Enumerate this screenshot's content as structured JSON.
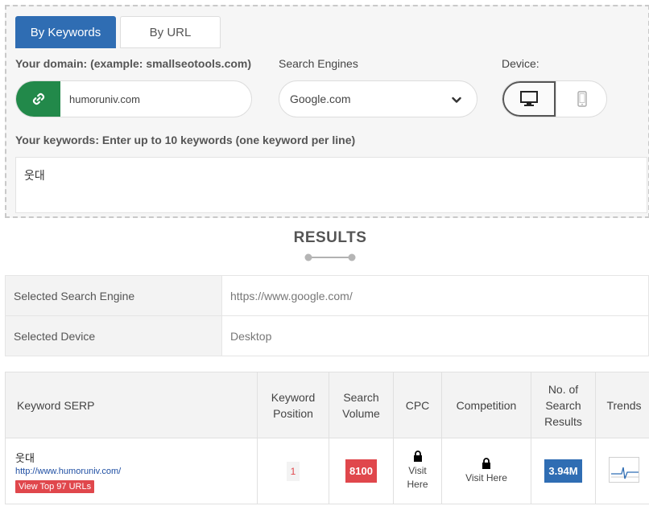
{
  "tabs": [
    {
      "label": "By Keywords",
      "active": true
    },
    {
      "label": "By URL",
      "active": false
    }
  ],
  "form": {
    "domain_label": "Your domain: (example: smallseotools.com)",
    "domain_value": "humoruniv.com",
    "engine_label": "Search Engines",
    "engine_value": "Google.com",
    "device_label": "Device:",
    "devices": [
      {
        "icon": "desktop-icon",
        "selected": true
      },
      {
        "icon": "mobile-icon",
        "selected": false
      }
    ],
    "keywords_label": "Your keywords: Enter up to 10 keywords (one keyword per line)",
    "keywords_value": "웃대"
  },
  "results": {
    "title": "RESULTS",
    "info": [
      {
        "key": "Selected Search Engine",
        "value": "https://www.google.com/"
      },
      {
        "key": "Selected Device",
        "value": "Desktop"
      }
    ]
  },
  "serp_table": {
    "columns": {
      "keyword": "Keyword SERP",
      "position": [
        "Keyword",
        "Position"
      ],
      "volume": [
        "Search",
        "Volume"
      ],
      "cpc": "CPC",
      "competition": "Competition",
      "results": [
        "No. of",
        "Search",
        "Results"
      ],
      "trends": "Trends"
    },
    "rows": [
      {
        "keyword": "웃대",
        "url": "http://www.humoruniv.com/",
        "top_urls": "View Top 97 URLs",
        "position": "1",
        "volume": "8100",
        "cpc_visit": [
          "Visit",
          "Here"
        ],
        "competition_visit": "Visit Here",
        "results": "3.94M"
      }
    ]
  },
  "colors": {
    "accent_blue": "#2f6db3",
    "accent_green": "#22894a",
    "accent_red": "#e0474c"
  }
}
